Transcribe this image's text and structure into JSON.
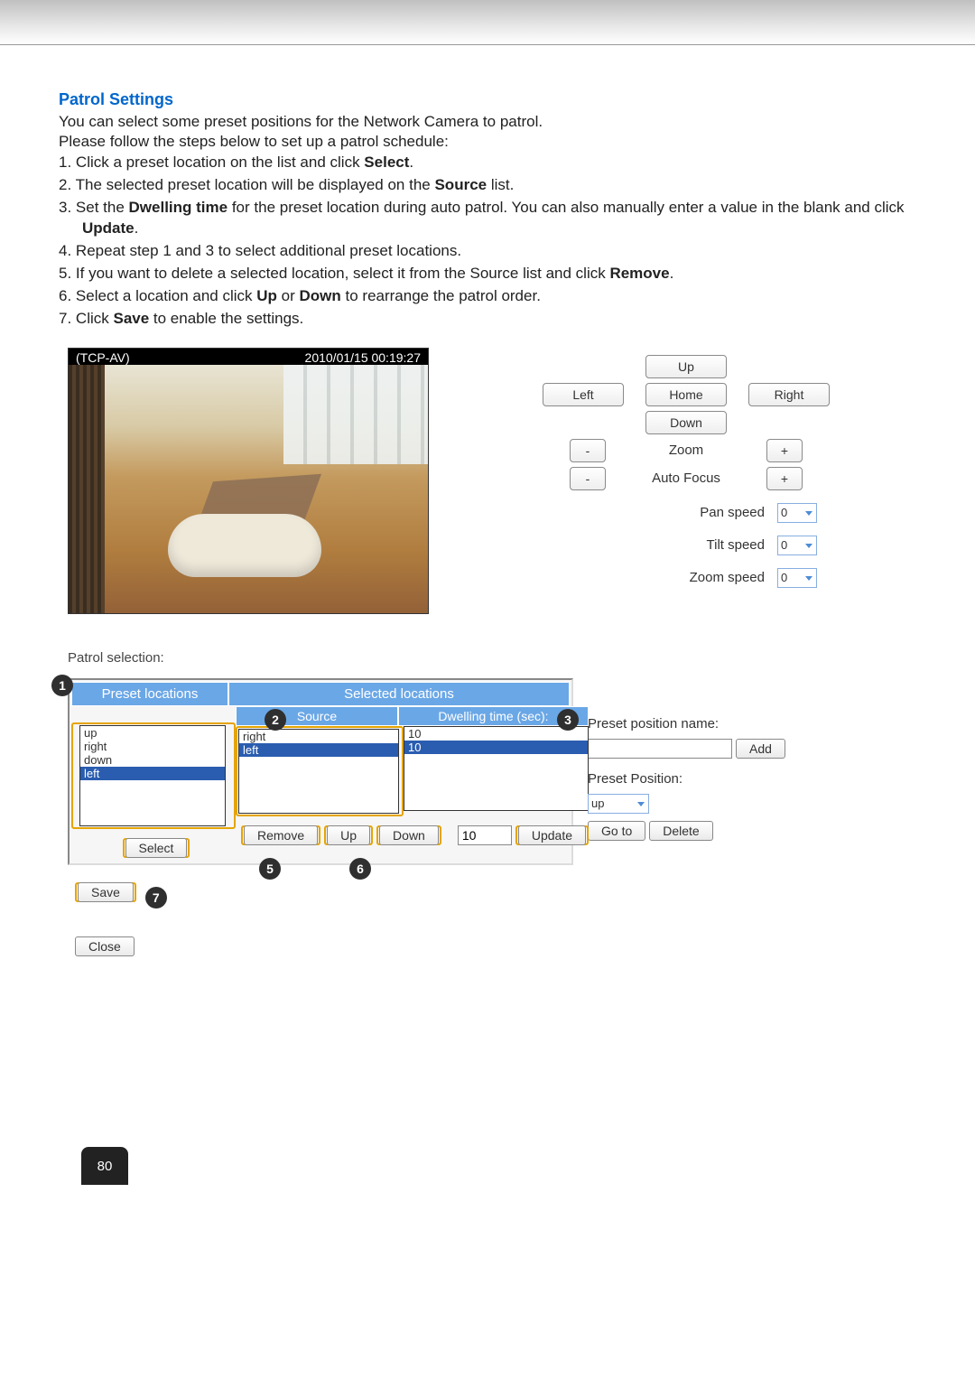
{
  "section_title": "Patrol Settings",
  "intro": "You can select some preset positions for the Network Camera to patrol.",
  "steps_intro": "Please follow the steps below to set up a patrol schedule:",
  "steps": [
    {
      "n": "1.",
      "pre": "Click a preset location on the list and click ",
      "bold": "Select",
      "post": "."
    },
    {
      "n": "2.",
      "pre": "The selected preset location will be displayed on the ",
      "bold": "Source",
      "post": " list."
    },
    {
      "n": "3.",
      "pre": "Set the ",
      "bold": "Dwelling time",
      "post": " for the preset location during auto patrol. You can also manually enter a value in the blank and click ",
      "bold2": "Update",
      "post2": "."
    },
    {
      "n": "4.",
      "pre": "Repeat step 1 and 3 to select additional preset locations.",
      "bold": "",
      "post": ""
    },
    {
      "n": "5.",
      "pre": "If you want to delete a selected location, select it from the Source list and click ",
      "bold": "Remove",
      "post": "."
    },
    {
      "n": "6.",
      "pre": "Select a location and click ",
      "bold": "Up",
      "post": " or ",
      "bold2": "Down",
      "post2": " to rearrange the patrol order."
    },
    {
      "n": "7.",
      "pre": "Click ",
      "bold": "Save",
      "post": " to enable the settings."
    }
  ],
  "camera": {
    "codec": "(TCP-AV)",
    "timestamp": "2010/01/15 00:19:27"
  },
  "ptz": {
    "up": "Up",
    "down": "Down",
    "left": "Left",
    "right": "Right",
    "home": "Home",
    "zoom": "Zoom",
    "autofocus": "Auto Focus",
    "minus": "-",
    "plus": "+",
    "pan_speed_label": "Pan speed",
    "tilt_speed_label": "Tilt speed",
    "zoom_speed_label": "Zoom speed",
    "pan_speed": "0",
    "tilt_speed": "0",
    "zoom_speed": "0"
  },
  "patrol": {
    "heading": "Patrol selection:",
    "headers": {
      "preset": "Preset locations",
      "selected": "Selected locations",
      "source": "Source",
      "dwell": "Dwelling time (sec):"
    },
    "preset_items": [
      "up",
      "right",
      "down",
      "left"
    ],
    "preset_selected_index": 3,
    "source_items": [
      "right",
      "left"
    ],
    "source_selected_index": 1,
    "dwell_items": [
      "10",
      "10"
    ],
    "dwell_selected_index": 1,
    "dwell_input": "10",
    "buttons": {
      "select": "Select",
      "remove": "Remove",
      "up": "Up",
      "down": "Down",
      "update": "Update",
      "save": "Save",
      "close": "Close"
    }
  },
  "preset_panel": {
    "name_label": "Preset position name:",
    "add": "Add",
    "pos_label": "Preset Position:",
    "pos_value": "up",
    "goto": "Go to",
    "delete": "Delete"
  },
  "callouts": {
    "1": "1",
    "2": "2",
    "3": "3",
    "5": "5",
    "6": "6",
    "7": "7"
  },
  "page_number": "80"
}
